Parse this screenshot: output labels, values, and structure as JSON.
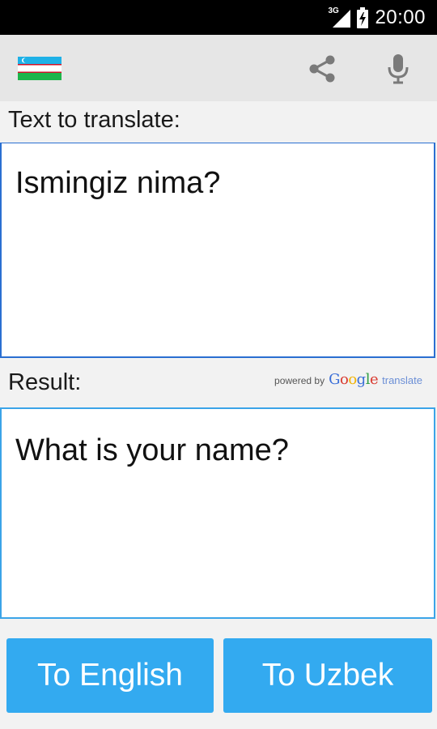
{
  "status_bar": {
    "network_type": "3G",
    "time": "20:00"
  },
  "action_bar": {
    "flag_icon": "uzbekistan-flag-icon",
    "share_icon": "share-icon",
    "mic_icon": "microphone-icon"
  },
  "input": {
    "label": "Text to translate:",
    "value": "Ismingiz nima?"
  },
  "result": {
    "label": "Result:",
    "value": "What is your name?",
    "powered_by": "powered by",
    "google": "Google",
    "translate": "translate"
  },
  "buttons": {
    "to_english": "To English",
    "to_uzbek": "To Uzbek"
  },
  "colors": {
    "button_bg": "#33aaf0",
    "input_border": "#2a6fd1",
    "result_border": "#3ba4e8",
    "actionbar_bg": "#e6e6e6"
  }
}
